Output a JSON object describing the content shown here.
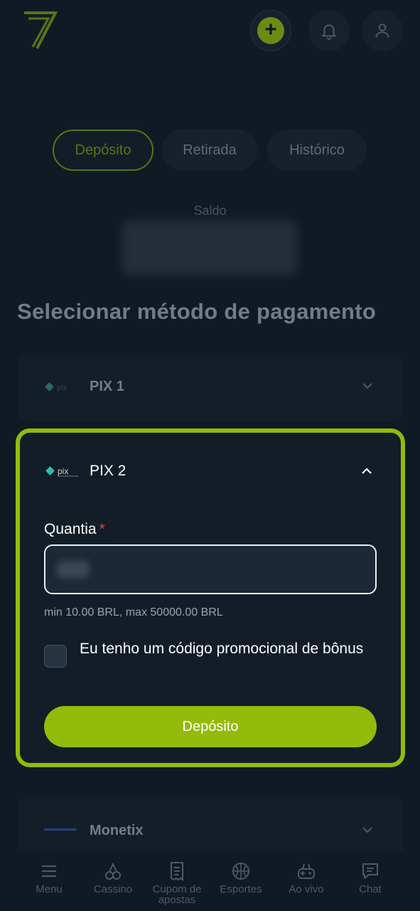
{
  "header": {
    "logo": "7-logo",
    "add_icon": "plus-icon",
    "bell_icon": "bell-icon",
    "user_icon": "user-icon"
  },
  "tabs": [
    {
      "label": "Depósito",
      "active": true
    },
    {
      "label": "Retirada",
      "active": false
    },
    {
      "label": "Histórico",
      "active": false
    }
  ],
  "balance": {
    "label": "Saldo"
  },
  "section_title": "Selecionar método de pagamento",
  "methods": [
    {
      "name": "PIX 1",
      "expanded": false
    },
    {
      "name": "PIX 2",
      "expanded": true
    },
    {
      "name": "Monetix",
      "expanded": false
    }
  ],
  "form": {
    "amount_label": "Quantia",
    "required_mark": "*",
    "limits": "min 10.00 BRL, max 50000.00 BRL",
    "promo_label": "Eu tenho um código promocional de bônus",
    "promo_checked": false,
    "submit_label": "Depósito"
  },
  "bottom_nav": [
    {
      "label": "Menu",
      "icon": "menu-icon"
    },
    {
      "label": "Cassino",
      "icon": "cherries-icon"
    },
    {
      "label": "Cupom de apostas",
      "icon": "ticket-icon"
    },
    {
      "label": "Esportes",
      "icon": "basketball-icon"
    },
    {
      "label": "Ao vivo",
      "icon": "gamepad-icon"
    },
    {
      "label": "Chat",
      "icon": "chat-icon"
    }
  ],
  "colors": {
    "accent": "#94bb0a",
    "background": "#111a24",
    "required": "#e0453f"
  }
}
